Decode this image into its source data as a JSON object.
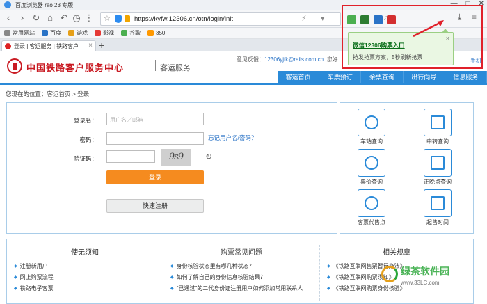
{
  "browser": {
    "title": "百度浏览器 rao 23 专版",
    "url": "https://kyfw.12306.cn/otn/login/init",
    "tab_label": "登录 | 客运服务 | 铁路客户"
  },
  "bookmarks": [
    {
      "label": "常用网站",
      "color": "#888888"
    },
    {
      "label": "百度",
      "color": "#2a73c6"
    },
    {
      "label": "游戏",
      "color": "#e6a019"
    },
    {
      "label": "影视",
      "color": "#e53935"
    },
    {
      "label": "谷歌",
      "color": "#4caf50"
    },
    {
      "label": "350",
      "color": "#ff9800"
    }
  ],
  "extension": {
    "popup_link": "微信12306购票入口",
    "popup_desc": "抢发抢票方案，5秒刷新抢票",
    "icon_colors": [
      "#4caf50",
      "#2e7d32",
      "#2a73c6",
      "#d32f2f"
    ]
  },
  "site": {
    "title": "中国铁路客户服务中心",
    "subtitle": "客运服务",
    "feedback_label": "意见反馈：",
    "feedback_email": "12306yjfk@rails.com.cn",
    "feedback_more": "您好",
    "mobile": "手机"
  },
  "nav": [
    "客运首页",
    "车票预订",
    "余票查询",
    "出行向导",
    "信息服务"
  ],
  "breadcrumb": {
    "prefix": "您现在的位置：",
    "home": "客运首页",
    "sep": " > ",
    "current": "登录"
  },
  "login": {
    "username_label": "登录名：",
    "username_placeholder": "用户名／邮箱",
    "password_label": "密码：",
    "captcha_label": "验证码：",
    "captcha_text": "9s9",
    "forgot": "忘记用户名/密码？",
    "submit": "登录",
    "register": "快速注册"
  },
  "services": [
    {
      "label": "车站查询"
    },
    {
      "label": "中转查询"
    },
    {
      "label": "票价查询"
    },
    {
      "label": "正晚点查询"
    },
    {
      "label": "客票代售点"
    },
    {
      "label": "起售时间"
    }
  ],
  "info": {
    "col1": {
      "title": "使无须知",
      "items": [
        "注册新用户",
        "网上购票流程",
        "铁路电子客票"
      ]
    },
    "col2": {
      "title": "购票常见问题",
      "items": [
        "身份核验状态里有哪几种状态？",
        "如何了解自己的身份信息核验结果？",
        "\"已通过\"的二代身份证注册用户如何添加常用联系人"
      ]
    },
    "col3": {
      "title": "相关规章",
      "items": [
        "《铁路互联网售票暂行办法》",
        "《铁路互联网购票须知》",
        "《铁路互联网购票身份核验》"
      ]
    }
  },
  "watermark": {
    "text": "绿茶软件园",
    "sub": "www.33LC.com"
  }
}
